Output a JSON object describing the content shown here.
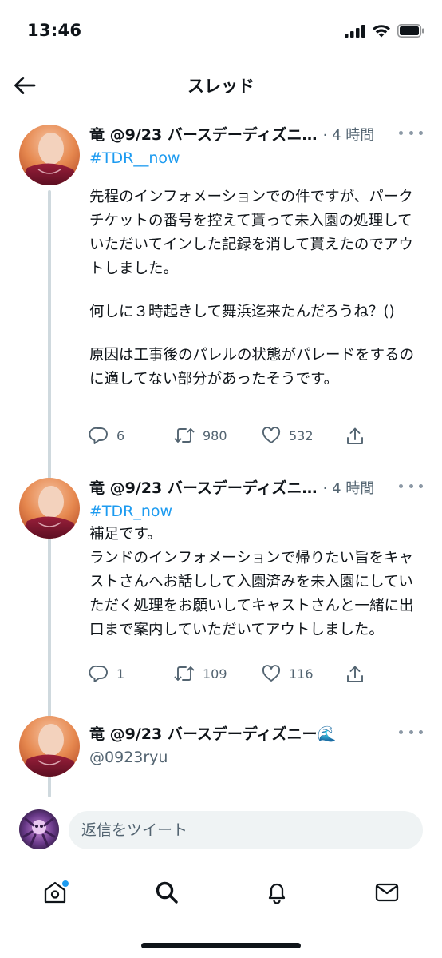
{
  "status_bar": {
    "time": "13:46"
  },
  "header": {
    "title": "スレッド"
  },
  "tweets": [
    {
      "author": "竜 @9/23 バースデーディズニ…",
      "time": "· 4 時間",
      "hashtag": "#TDR__now",
      "paragraphs": [
        "先程のインフォメーションでの件ですが、パークチケットの番号を控えて貰って未入園の処理していただいてインした記録を消して貰えたのでアウトしました。",
        "何しに３時起きして舞浜迄来たんだろうね？()",
        "原因は工事後のパレルの状態がパレードをするのに適してない部分があったそうです。"
      ],
      "replies": "6",
      "retweets": "980",
      "likes": "532"
    },
    {
      "author": "竜 @9/23 バースデーディズニ…",
      "time": "· 4 時間",
      "hashtag": "#TDR_now",
      "paragraphs": [
        "補足です。\nランドのインフォメーションで帰りたい旨をキャストさんへお話しして入園済みを未入園にしていただく処理をお願いしてキャストさんと一緒に出口まで案内していただいてアウトしました。"
      ],
      "replies": "1",
      "retweets": "109",
      "likes": "116"
    }
  ],
  "current_tweet": {
    "author": "竜 @9/23 バースデーディズニー🌊",
    "handle": "@0923ryu"
  },
  "reply_bar": {
    "placeholder": "返信をツイート"
  },
  "tabs": [
    "home-icon",
    "search-icon",
    "notifications-icon",
    "messages-icon"
  ],
  "colors": {
    "accent": "#1d9bf0",
    "muted": "#536471",
    "thread_line": "#cfd9de"
  }
}
